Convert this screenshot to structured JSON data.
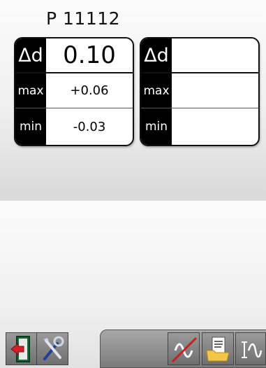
{
  "header": {
    "part_id": "P 11112"
  },
  "panels": [
    {
      "delta_label": "Δd",
      "delta_value": "0.10",
      "max_label": "max",
      "max_value": "+0.06",
      "min_label": "min",
      "min_value": "-0.03"
    },
    {
      "delta_label": "Δd",
      "delta_value": "",
      "max_label": "max",
      "max_value": "",
      "min_label": "min",
      "min_value": ""
    }
  ],
  "toolbar": {
    "icons": [
      "exit-door-icon",
      "tools-icon",
      "wave-disabled-icon",
      "document-folder-icon",
      "wave-measure-icon"
    ]
  }
}
